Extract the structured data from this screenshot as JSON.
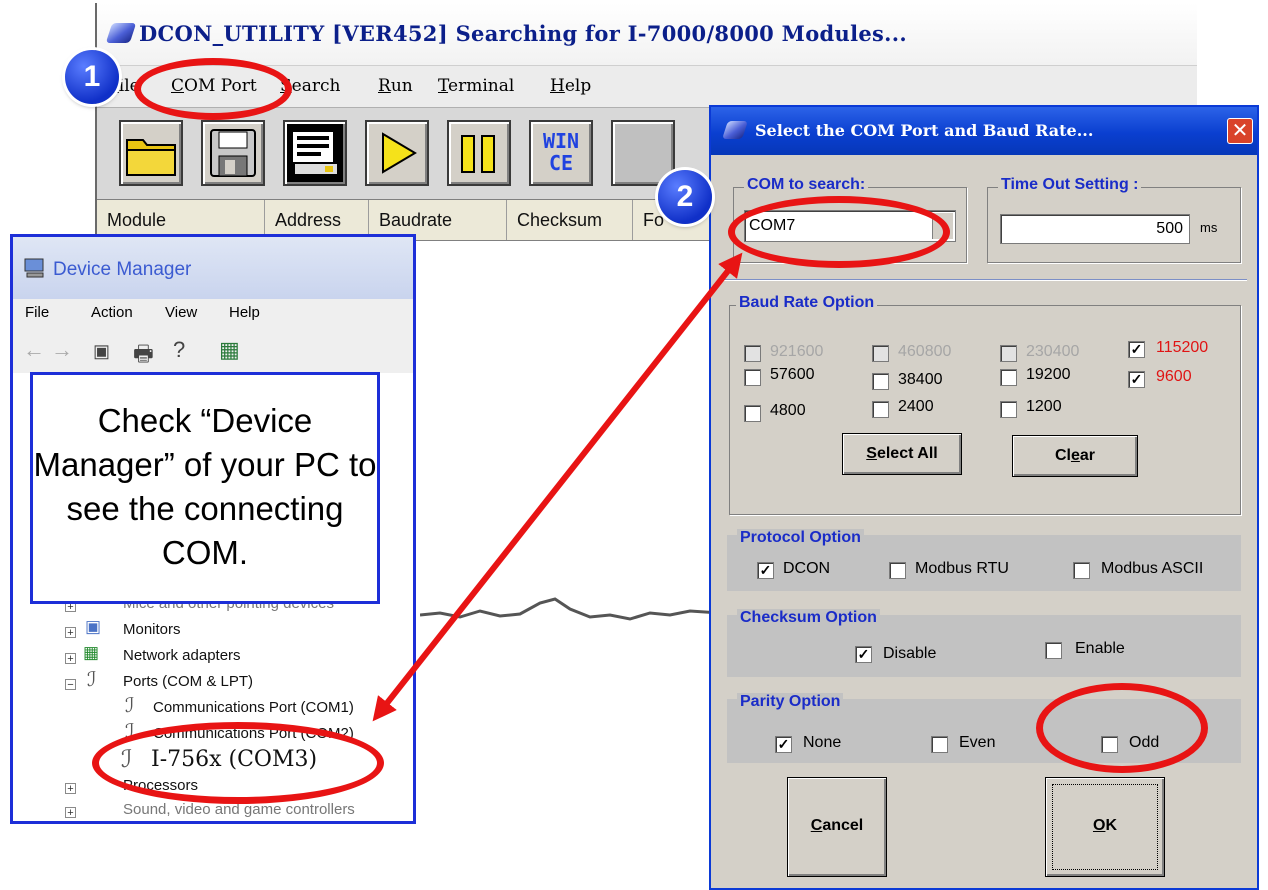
{
  "dcon": {
    "title": "DCON_UTILITY [VER452] Searching for I-7000/8000 Modules...",
    "menu": [
      {
        "first": "F",
        "rest": "ile"
      },
      {
        "first": "C",
        "rest": "OM Port"
      },
      {
        "first": "S",
        "rest": "earch"
      },
      {
        "first": "R",
        "rest": "un"
      },
      {
        "first": "T",
        "rest": "erminal"
      },
      {
        "first": "H",
        "rest": "elp"
      }
    ],
    "toolbar_wince": "WIN CE",
    "columns": [
      "Module",
      "Address",
      "Baudrate",
      "Checksum",
      "Fo"
    ]
  },
  "device_manager": {
    "title": "Device Manager",
    "menu": [
      "File",
      "Action",
      "View",
      "Help"
    ],
    "tree": {
      "mice": "Mice and other pointing devices",
      "monitors": "Monitors",
      "network": "Network adapters",
      "ports": "Ports (COM & LPT)",
      "port1": "Communications Port (COM1)",
      "port2": "Communications Port (COM2)",
      "port3": "I-756x (COM3)",
      "processors": "Processors",
      "sound": "Sound, video and game controllers"
    }
  },
  "callout": {
    "text": "Check “Device Manager” of your PC to see the connecting COM."
  },
  "dialog": {
    "title": "Select the COM Port and Baud Rate...",
    "com_group": "COM to search:",
    "com_value": "COM7",
    "timeout_group": "Time Out Setting :",
    "timeout_value": "500",
    "timeout_unit": "ms",
    "baud_group": "Baud Rate Option",
    "baud_rates": [
      {
        "label": "921600",
        "checked": false,
        "disabled": true
      },
      {
        "label": "460800",
        "checked": false,
        "disabled": true
      },
      {
        "label": "230400",
        "checked": false,
        "disabled": true
      },
      {
        "label": "115200",
        "checked": true,
        "disabled": false
      },
      {
        "label": "57600",
        "checked": false,
        "disabled": false
      },
      {
        "label": "38400",
        "checked": false,
        "disabled": false
      },
      {
        "label": "19200",
        "checked": false,
        "disabled": false
      },
      {
        "label": "9600",
        "checked": true,
        "disabled": false
      },
      {
        "label": "4800",
        "checked": false,
        "disabled": false
      },
      {
        "label": "2400",
        "checked": false,
        "disabled": false
      },
      {
        "label": "1200",
        "checked": false,
        "disabled": false
      }
    ],
    "select_all": {
      "first": "S",
      "rest": "elect  All"
    },
    "clear": {
      "pre": "Cl",
      "u": "e",
      "post": "ar"
    },
    "protocol_group": "Protocol Option",
    "protocols": [
      {
        "label": "DCON",
        "checked": true
      },
      {
        "label": "Modbus RTU",
        "checked": false
      },
      {
        "label": "Modbus ASCII",
        "checked": false
      }
    ],
    "checksum_group": "Checksum  Option",
    "checksum": [
      {
        "label": "Disable",
        "checked": true
      },
      {
        "label": "Enable",
        "checked": false
      }
    ],
    "parity_group": "Parity Option",
    "parity": [
      {
        "label": "None",
        "checked": true
      },
      {
        "label": "Even",
        "checked": false
      },
      {
        "label": "Odd",
        "checked": false
      }
    ],
    "cancel": {
      "first": "C",
      "rest": "ancel"
    },
    "ok": {
      "first": "O",
      "rest": "K"
    }
  },
  "annotations": {
    "step1": "1",
    "step2": "2"
  },
  "colors": {
    "annotation_red": "#e81414",
    "badge_blue": "#1030c8",
    "accent_blue": "#1a2cc8"
  }
}
